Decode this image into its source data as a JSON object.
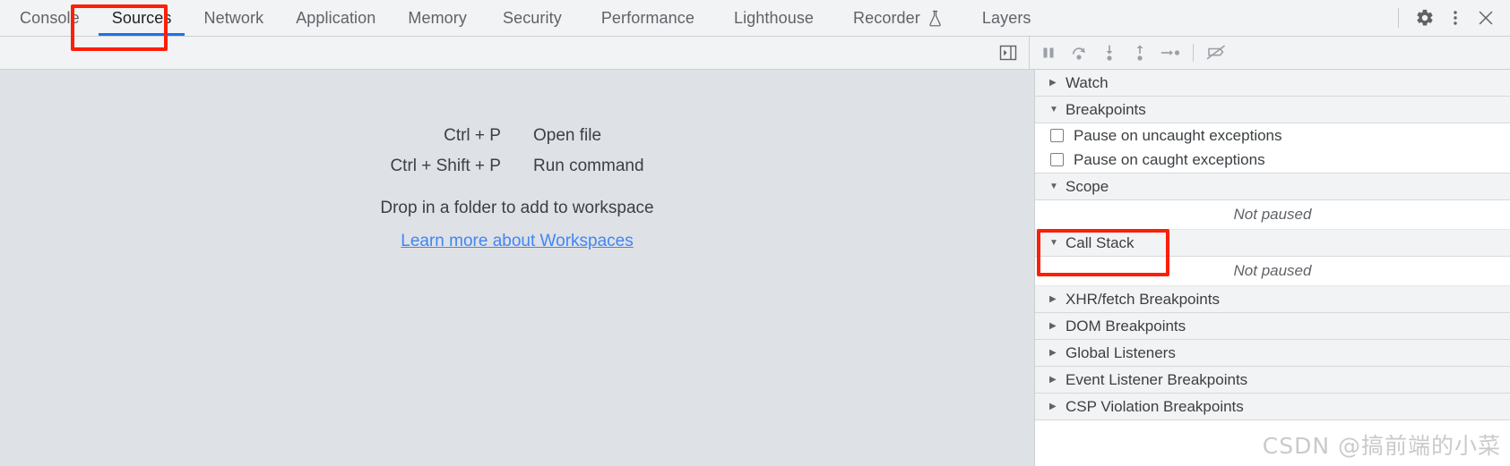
{
  "tabbar": {
    "tabs": [
      {
        "label": "Console",
        "selected": false,
        "icon": null
      },
      {
        "label": "Sources",
        "selected": true,
        "icon": null
      },
      {
        "label": "Network",
        "selected": false,
        "icon": null
      },
      {
        "label": "Application",
        "selected": false,
        "icon": null
      },
      {
        "label": "Memory",
        "selected": false,
        "icon": null
      },
      {
        "label": "Security",
        "selected": false,
        "icon": null
      },
      {
        "label": "Performance",
        "selected": false,
        "icon": null
      },
      {
        "label": "Lighthouse",
        "selected": false,
        "icon": null
      },
      {
        "label": "Recorder",
        "selected": false,
        "icon": "flask-icon"
      },
      {
        "label": "Layers",
        "selected": false,
        "icon": null
      }
    ],
    "actions": [
      {
        "name": "settings-gear-icon",
        "title": "Settings"
      },
      {
        "name": "more-options-icon",
        "title": "Customize and control DevTools"
      },
      {
        "name": "close-icon",
        "title": "Close DevTools"
      }
    ]
  },
  "toolbar": {
    "show_navigator_label": "Show navigator",
    "debugger_buttons": [
      {
        "name": "pause-script-execution-icon",
        "title": "Pause script execution"
      },
      {
        "name": "step-over-icon",
        "title": "Step over next function call"
      },
      {
        "name": "step-into-icon",
        "title": "Step into next function call"
      },
      {
        "name": "step-out-icon",
        "title": "Step out of current function"
      },
      {
        "name": "step-icon",
        "title": "Step"
      },
      {
        "name": "deactivate-breakpoints-icon",
        "title": "Deactivate breakpoints"
      }
    ]
  },
  "editor": {
    "shortcuts": [
      {
        "keys": "Ctrl + P",
        "action": "Open file"
      },
      {
        "keys": "Ctrl + Shift + P",
        "action": "Run command"
      }
    ],
    "drop_hint": "Drop in a folder to add to workspace",
    "learn_more_link": "Learn more about Workspaces"
  },
  "sidebar": {
    "sections": [
      {
        "label": "Watch",
        "expanded": false
      },
      {
        "label": "Breakpoints",
        "expanded": true
      },
      {
        "label": "Scope",
        "expanded": true
      },
      {
        "label": "Call Stack",
        "expanded": true,
        "highlighted": true
      },
      {
        "label": "XHR/fetch Breakpoints",
        "expanded": false
      },
      {
        "label": "DOM Breakpoints",
        "expanded": false
      },
      {
        "label": "Global Listeners",
        "expanded": false
      },
      {
        "label": "Event Listener Breakpoints",
        "expanded": false
      },
      {
        "label": "CSP Violation Breakpoints",
        "expanded": false
      }
    ],
    "breakpoint_options": [
      {
        "label": "Pause on uncaught exceptions",
        "checked": false
      },
      {
        "label": "Pause on caught exceptions",
        "checked": false
      }
    ],
    "scope_empty_message": "Not paused",
    "callstack_empty_message": "Not paused"
  },
  "annotations": {
    "highlight_color": "#fc1f07",
    "boxes": [
      {
        "name": "sources-tab-highlight",
        "target": "Sources"
      },
      {
        "name": "call-stack-highlight",
        "target": "Call Stack"
      }
    ]
  },
  "watermark": {
    "text": "CSDN @搞前端的小菜"
  }
}
